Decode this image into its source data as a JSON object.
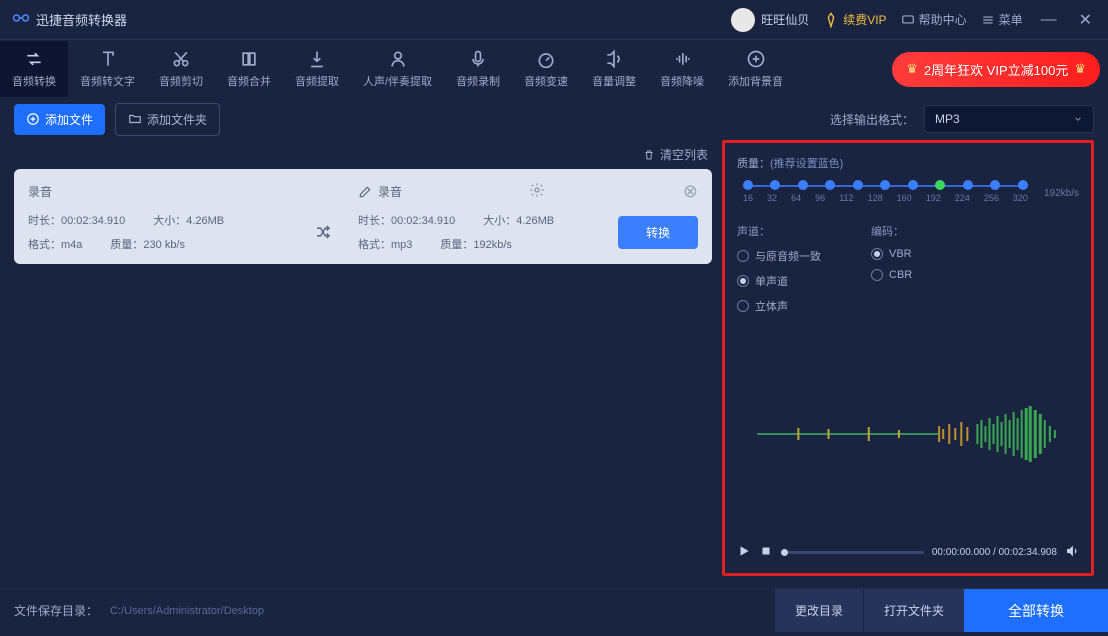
{
  "app": {
    "title": "迅捷音频转换器"
  },
  "user": {
    "name": "旺旺仙贝"
  },
  "vip": {
    "label": "续费VIP"
  },
  "title_actions": {
    "help": "帮助中心",
    "menu": "菜单"
  },
  "toolbar": {
    "items": [
      {
        "label": "音频转换"
      },
      {
        "label": "音频转文字"
      },
      {
        "label": "音频剪切"
      },
      {
        "label": "音频合并"
      },
      {
        "label": "音频提取"
      },
      {
        "label": "人声/伴奏提取"
      },
      {
        "label": "音频录制"
      },
      {
        "label": "音频变速"
      },
      {
        "label": "音量调整"
      },
      {
        "label": "音频降噪"
      },
      {
        "label": "添加背景音"
      }
    ]
  },
  "promo": {
    "text": "2周年狂欢 VIP立减100元"
  },
  "actions": {
    "add_file": "添加文件",
    "add_folder": "添加文件夹"
  },
  "output": {
    "label": "选择输出格式：",
    "value": "MP3"
  },
  "list": {
    "clear": "清空列表"
  },
  "file": {
    "name_left": "录音",
    "name_right": "录音",
    "left": {
      "duration_k": "时长：",
      "duration_v": "00:02:34.910",
      "size_k": "大小：",
      "size_v": "4.26MB",
      "format_k": "格式：",
      "format_v": "m4a",
      "quality_k": "质量：",
      "quality_v": "230 kb/s"
    },
    "right": {
      "duration_k": "时长：",
      "duration_v": "00:02:34.910",
      "size_k": "大小：",
      "size_v": "4.26MB",
      "format_k": "格式：",
      "format_v": "mp3",
      "quality_k": "质量：",
      "quality_v": "192kb/s"
    },
    "convert": "转换"
  },
  "settings": {
    "quality_label": "质量：",
    "quality_rec": "(推荐设置蓝色)",
    "current_rate": "192kb/s",
    "ticks": [
      "16",
      "32",
      "64",
      "96",
      "112",
      "128",
      "160",
      "192",
      "224",
      "256",
      "320"
    ],
    "channel": {
      "head": "声道：",
      "opts": [
        "与原音频一致",
        "单声道",
        "立体声"
      ],
      "selected": 1
    },
    "encoding": {
      "head": "编码：",
      "opts": [
        "VBR",
        "CBR"
      ],
      "selected": 0
    }
  },
  "player": {
    "pos": "00:00:00.000",
    "sep": " / ",
    "dur": "00:02:34.908"
  },
  "footer": {
    "save_label": "文件保存目录：",
    "save_path": "C:/Users/Administrator/Desktop",
    "change_dir": "更改目录",
    "open_dir": "打开文件夹",
    "convert_all": "全部转换"
  }
}
